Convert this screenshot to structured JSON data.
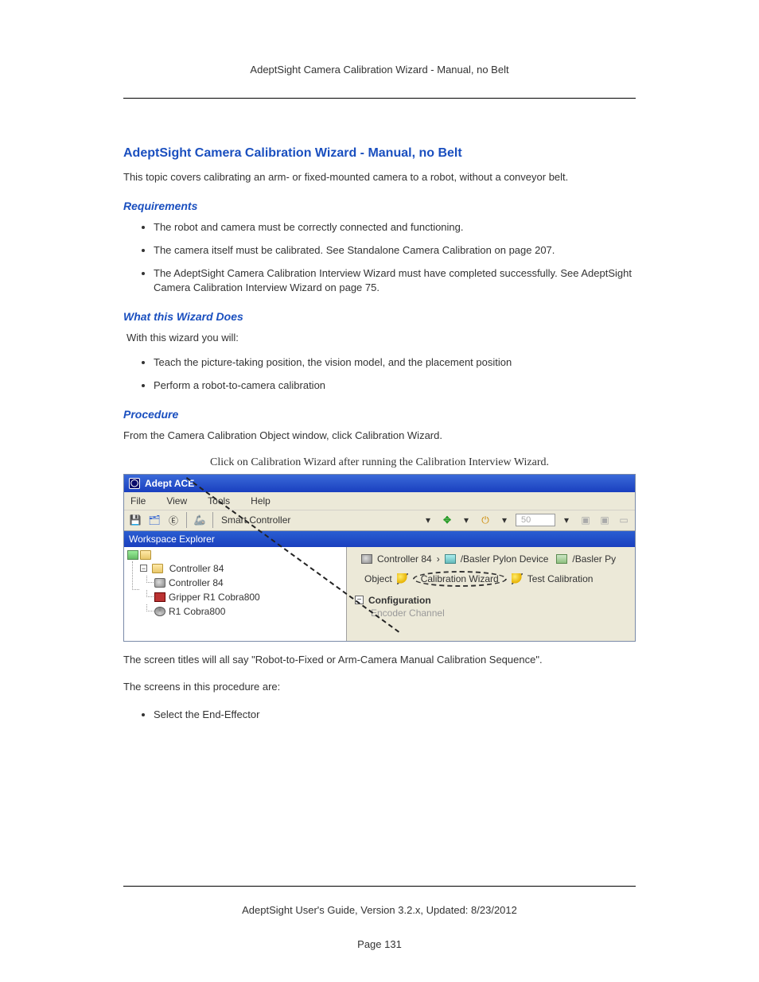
{
  "header": "AdeptSight Camera Calibration Wizard - Manual, no Belt",
  "title": "AdeptSight Camera Calibration Wizard - Manual, no Belt",
  "intro": "This topic covers calibrating an arm- or fixed-mounted camera to a robot, without a conveyor belt.",
  "sections": {
    "requirements": {
      "heading": "Requirements",
      "items": [
        "The robot and camera must be correctly connected and functioning.",
        "The camera itself must be calibrated. See Standalone Camera Calibration on page 207.",
        "The AdeptSight Camera Calibration Interview Wizard must have completed successfully. See AdeptSight Camera Calibration Interview Wizard on page 75."
      ]
    },
    "what": {
      "heading": "What this Wizard Does",
      "intro": "With this wizard you will:",
      "items": [
        "Teach the picture-taking position, the vision model, and the placement position",
        "Perform a robot-to-camera calibration"
      ]
    },
    "procedure": {
      "heading": "Procedure",
      "intro": "From the Camera Calibration Object window, click Calibration Wizard.",
      "caption": "Click on Calibration Wizard after running the Calibration Interview Wizard.",
      "after1": "The screen titles will all say \"Robot-to-Fixed or Arm-Camera Manual Calibration Sequence\".",
      "after2": "The screens in this procedure are:",
      "items": [
        "Select the End-Effector"
      ]
    }
  },
  "app": {
    "title": "Adept ACE",
    "menus": [
      "File",
      "View",
      "Tools",
      "Help"
    ],
    "toolbar": {
      "smart_controller": "Smart Controller",
      "speed": "50"
    },
    "panel_title": "Workspace Explorer",
    "tree": {
      "root": "Controller 84",
      "children": [
        "Controller 84",
        "Gripper R1 Cobra800",
        "R1 Cobra800"
      ]
    },
    "breadcrumb": {
      "b1": "Controller 84",
      "b2": "/Basler Pylon Device",
      "b3": "/Basler Py"
    },
    "actions": {
      "object": "Object",
      "cal_wizard": "Calibration Wizard",
      "test_cal": "Test Calibration"
    },
    "config": {
      "label": "Configuration",
      "sub": "Encoder Channel"
    }
  },
  "footer": {
    "text": "AdeptSight User's Guide,  Version 3.2.x, Updated: 8/23/2012",
    "page": "Page 131"
  }
}
